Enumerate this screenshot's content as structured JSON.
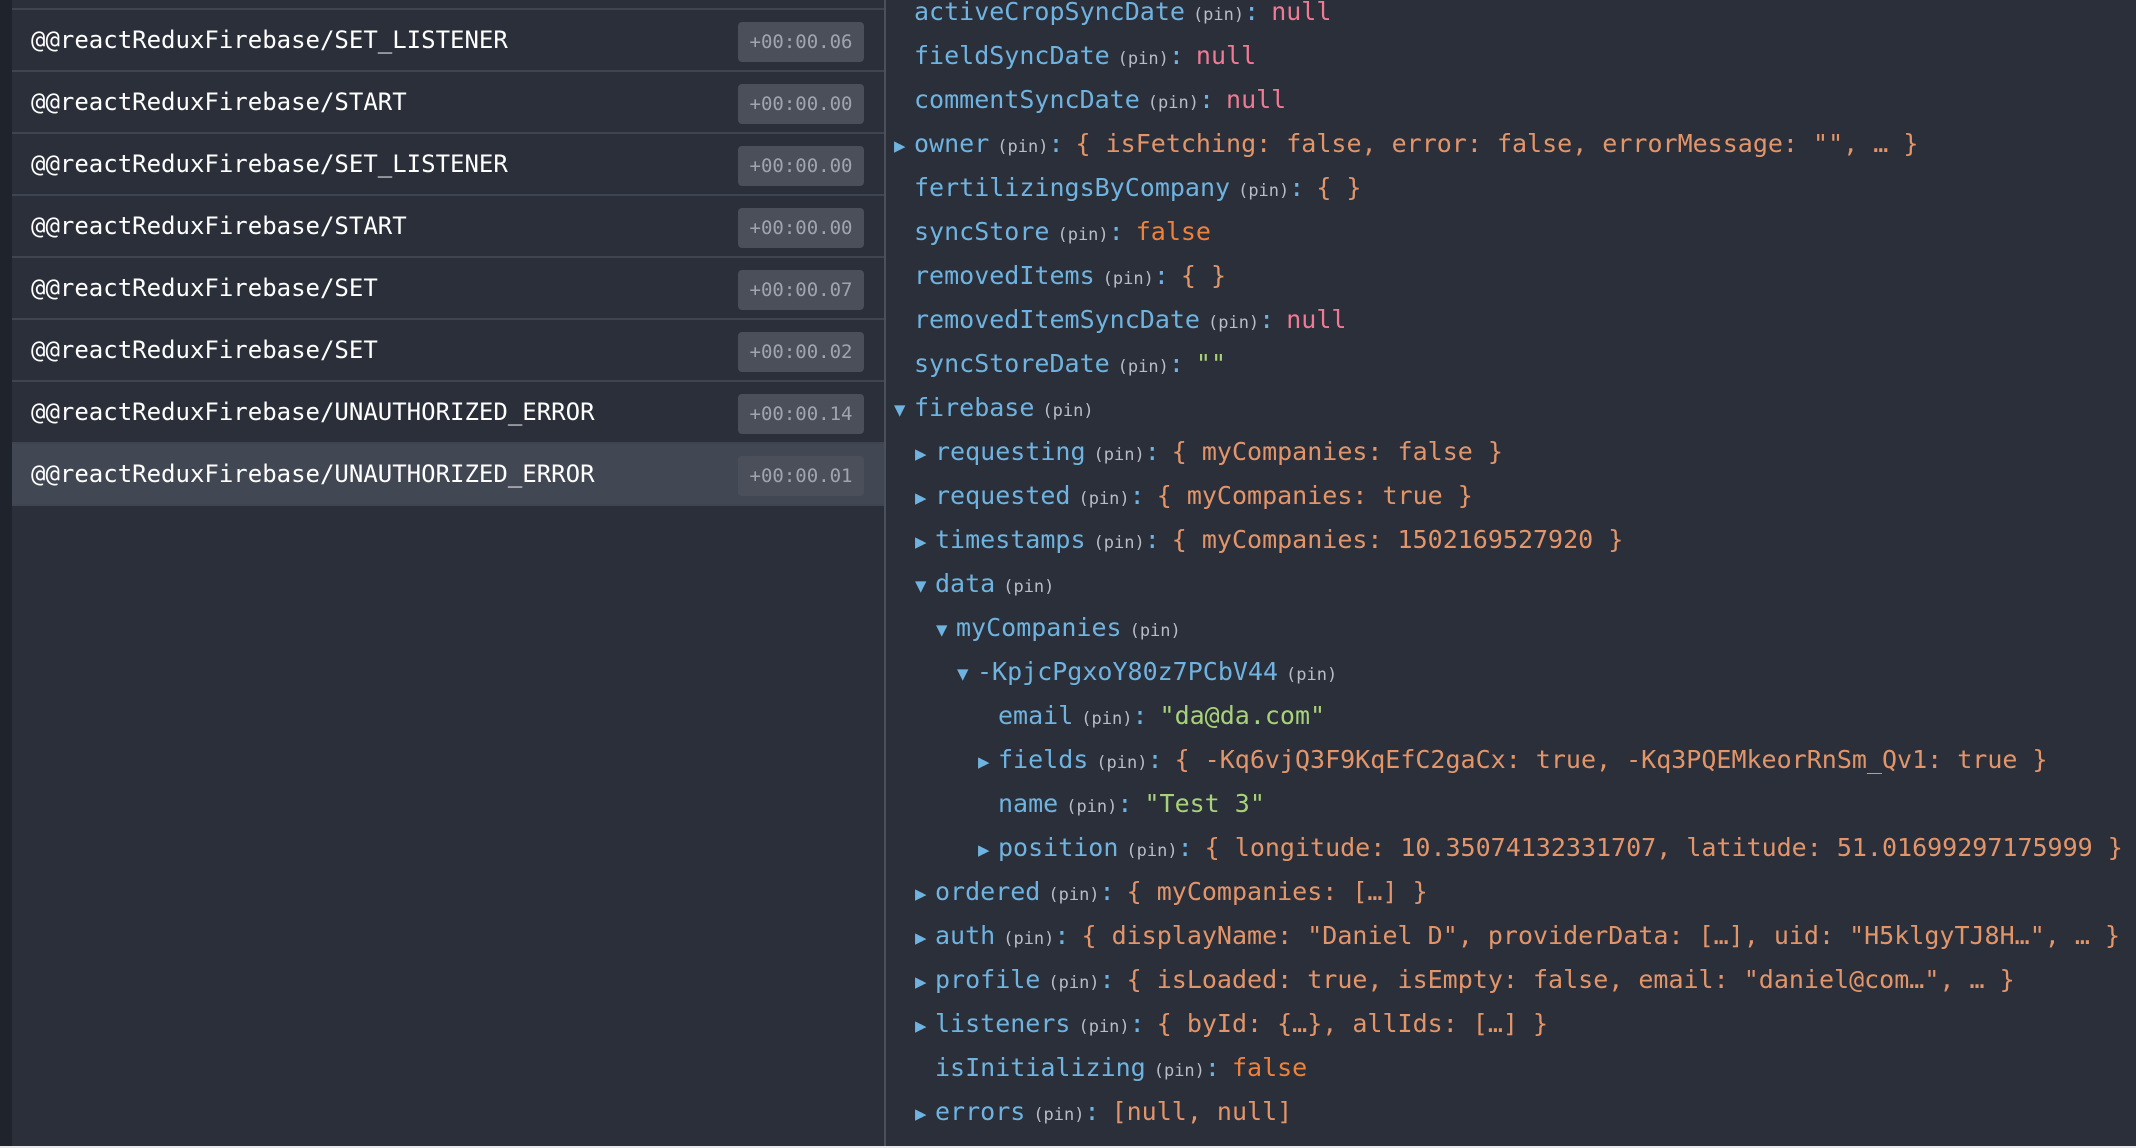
{
  "actions": [
    {
      "name": "@@reactReduxFirebase/SET_LISTENER",
      "time": "+00:00.06",
      "selected": false
    },
    {
      "name": "@@reactReduxFirebase/START",
      "time": "+00:00.00",
      "selected": false
    },
    {
      "name": "@@reactReduxFirebase/SET_LISTENER",
      "time": "+00:00.00",
      "selected": false
    },
    {
      "name": "@@reactReduxFirebase/START",
      "time": "+00:00.00",
      "selected": false
    },
    {
      "name": "@@reactReduxFirebase/SET",
      "time": "+00:00.07",
      "selected": false
    },
    {
      "name": "@@reactReduxFirebase/SET",
      "time": "+00:00.02",
      "selected": false
    },
    {
      "name": "@@reactReduxFirebase/UNAUTHORIZED_ERROR",
      "time": "+00:00.14",
      "selected": false
    },
    {
      "name": "@@reactReduxFirebase/UNAUTHORIZED_ERROR",
      "time": "+00:00.01",
      "selected": true
    }
  ],
  "pin_label": "(pin)",
  "colors": {
    "background": "#2a2f3a",
    "key": "#6fb3e0",
    "null": "#f07a94",
    "boolean": "#f0813a",
    "string": "#a8d279",
    "object": "#e3956a",
    "selected_row": "#414753"
  },
  "tree": [
    {
      "key": "activeCropSyncDate",
      "indent": 0,
      "arrow": "none",
      "colon": true,
      "value": "null",
      "vtype": "null"
    },
    {
      "key": "fieldSyncDate",
      "indent": 0,
      "arrow": "none",
      "colon": true,
      "value": "null",
      "vtype": "null"
    },
    {
      "key": "commentSyncDate",
      "indent": 0,
      "arrow": "none",
      "colon": true,
      "value": "null",
      "vtype": "null"
    },
    {
      "key": "owner",
      "indent": 0,
      "arrow": "collapsed",
      "colon": true,
      "value": "{ isFetching: false, error: false, errorMessage: \"\", … }",
      "vtype": "obj"
    },
    {
      "key": "fertilizingsByCompany",
      "indent": 0,
      "arrow": "none",
      "colon": true,
      "value": "{ }",
      "vtype": "obj"
    },
    {
      "key": "syncStore",
      "indent": 0,
      "arrow": "none",
      "colon": true,
      "value": "false",
      "vtype": "bool"
    },
    {
      "key": "removedItems",
      "indent": 0,
      "arrow": "none",
      "colon": true,
      "value": "{ }",
      "vtype": "obj"
    },
    {
      "key": "removedItemSyncDate",
      "indent": 0,
      "arrow": "none",
      "colon": true,
      "value": "null",
      "vtype": "null"
    },
    {
      "key": "syncStoreDate",
      "indent": 0,
      "arrow": "none",
      "colon": true,
      "value": "\"\"",
      "vtype": "str"
    },
    {
      "key": "firebase",
      "indent": 0,
      "arrow": "expanded",
      "colon": false,
      "value": "",
      "vtype": "obj"
    },
    {
      "key": "requesting",
      "indent": 1,
      "arrow": "collapsed",
      "colon": true,
      "value": "{ myCompanies: false }",
      "vtype": "obj"
    },
    {
      "key": "requested",
      "indent": 1,
      "arrow": "collapsed",
      "colon": true,
      "value": "{ myCompanies: true }",
      "vtype": "obj"
    },
    {
      "key": "timestamps",
      "indent": 1,
      "arrow": "collapsed",
      "colon": true,
      "value": "{ myCompanies: 1502169527920 }",
      "vtype": "obj"
    },
    {
      "key": "data",
      "indent": 1,
      "arrow": "expanded",
      "colon": false,
      "value": "",
      "vtype": "obj"
    },
    {
      "key": "myCompanies",
      "indent": 2,
      "arrow": "expanded",
      "colon": false,
      "value": "",
      "vtype": "obj"
    },
    {
      "key": "-KpjcPgxoY80z7PCbV44",
      "indent": 3,
      "arrow": "expanded",
      "colon": false,
      "value": "",
      "vtype": "obj"
    },
    {
      "key": "email",
      "indent": 4,
      "arrow": "none",
      "colon": true,
      "value": "\"da@da.com\"",
      "vtype": "str"
    },
    {
      "key": "fields",
      "indent": 4,
      "arrow": "collapsed",
      "colon": true,
      "value": "{ -Kq6vjQ3F9KqEfC2gaCx: true, -Kq3PQEMkeorRnSm_Qv1: true }",
      "vtype": "obj"
    },
    {
      "key": "name",
      "indent": 4,
      "arrow": "none",
      "colon": true,
      "value": "\"Test 3\"",
      "vtype": "str"
    },
    {
      "key": "position",
      "indent": 4,
      "arrow": "collapsed",
      "colon": true,
      "value": "{ longitude: 10.35074132331707, latitude: 51.01699297175999 }",
      "vtype": "obj"
    },
    {
      "key": "ordered",
      "indent": 1,
      "arrow": "collapsed",
      "colon": true,
      "value": "{ myCompanies: […] }",
      "vtype": "obj"
    },
    {
      "key": "auth",
      "indent": 1,
      "arrow": "collapsed",
      "colon": true,
      "value": "{ displayName: \"Daniel D\", providerData: […], uid: \"H5klgyTJ8H…\", … }",
      "vtype": "obj"
    },
    {
      "key": "profile",
      "indent": 1,
      "arrow": "collapsed",
      "colon": true,
      "value": "{ isLoaded: true, isEmpty: false, email: \"daniel@com…\", … }",
      "vtype": "obj"
    },
    {
      "key": "listeners",
      "indent": 1,
      "arrow": "collapsed",
      "colon": true,
      "value": "{ byId: {…}, allIds: […] }",
      "vtype": "obj"
    },
    {
      "key": "isInitializing",
      "indent": 1,
      "arrow": "none",
      "colon": true,
      "value": "false",
      "vtype": "bool"
    },
    {
      "key": "errors",
      "indent": 1,
      "arrow": "collapsed",
      "colon": true,
      "value": "[null, null]",
      "vtype": "obj"
    }
  ]
}
